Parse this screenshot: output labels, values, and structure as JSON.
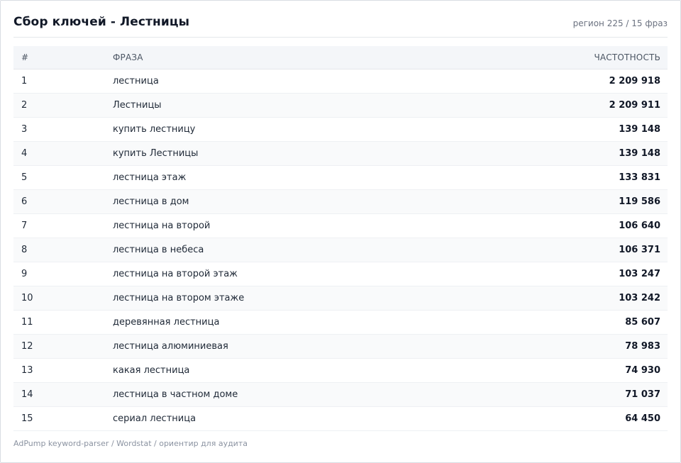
{
  "header": {
    "title": "Сбор ключей - Лестницы",
    "meta": "регион 225 / 15 фраз"
  },
  "table": {
    "columns": {
      "num": "#",
      "phrase": "ФРАЗА",
      "freq": "ЧАСТОТНОСТЬ"
    },
    "rows": [
      {
        "num": "1",
        "phrase": "лестница",
        "freq": "2 209 918"
      },
      {
        "num": "2",
        "phrase": "Лестницы",
        "freq": "2 209 911"
      },
      {
        "num": "3",
        "phrase": "купить лестницу",
        "freq": "139 148"
      },
      {
        "num": "4",
        "phrase": "купить Лестницы",
        "freq": "139 148"
      },
      {
        "num": "5",
        "phrase": "лестница этаж",
        "freq": "133 831"
      },
      {
        "num": "6",
        "phrase": "лестница в дом",
        "freq": "119 586"
      },
      {
        "num": "7",
        "phrase": "лестница на второй",
        "freq": "106 640"
      },
      {
        "num": "8",
        "phrase": "лестница в небеса",
        "freq": "106 371"
      },
      {
        "num": "9",
        "phrase": "лестница на второй этаж",
        "freq": "103 247"
      },
      {
        "num": "10",
        "phrase": "лестница на втором этаже",
        "freq": "103 242"
      },
      {
        "num": "11",
        "phrase": "деревянная лестница",
        "freq": "85 607"
      },
      {
        "num": "12",
        "phrase": "лестница алюминиевая",
        "freq": "78 983"
      },
      {
        "num": "13",
        "phrase": "какая лестница",
        "freq": "74 930"
      },
      {
        "num": "14",
        "phrase": "лестница в частном доме",
        "freq": "71 037"
      },
      {
        "num": "15",
        "phrase": "сериал лестница",
        "freq": "64 450"
      }
    ]
  },
  "footer": {
    "text": "AdPump keyword-parser / Wordstat / ориентир для аудита"
  }
}
